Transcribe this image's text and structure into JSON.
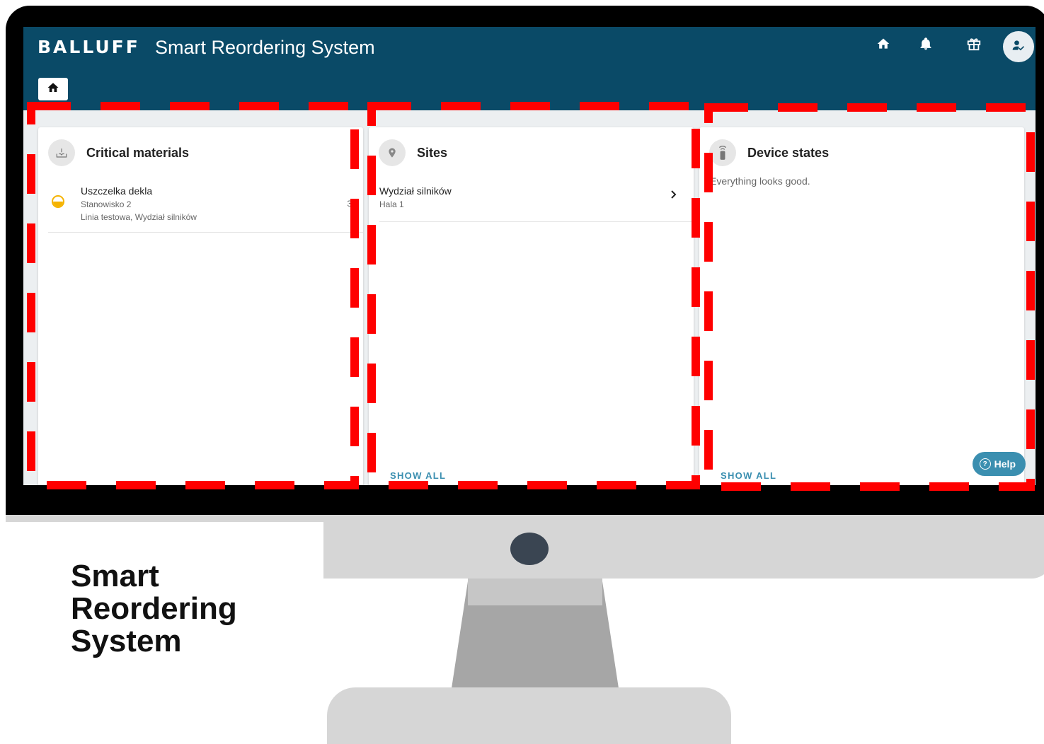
{
  "app": {
    "logo": "BALLUFF",
    "title": "Smart Reordering System"
  },
  "topbar_icons": [
    "home-icon",
    "bell-icon",
    "gift-icon",
    "user-check-icon"
  ],
  "cards": {
    "critical": {
      "title": "Critical materials",
      "icon": "inbox-download-icon",
      "items": [
        {
          "name": "Uszczelka dekla",
          "station": "Stanowisko 2",
          "location": "Linia testowa, Wydział silników",
          "count": "3",
          "status_color": "#f5b301"
        }
      ]
    },
    "sites": {
      "title": "Sites",
      "icon": "map-pin-icon",
      "items": [
        {
          "name": "Wydział silników",
          "sub": "Hala 1"
        }
      ],
      "show_all": "SHOW ALL"
    },
    "devices": {
      "title": "Device states",
      "icon": "remote-device-icon",
      "message": "Everything looks good.",
      "show_all": "SHOW ALL"
    }
  },
  "help": {
    "label": "Help",
    "glyph": "?"
  },
  "marketing": {
    "line1": "Smart",
    "line2": "Reordering",
    "line3": "System"
  },
  "colors": {
    "appbar": "#0a4a67",
    "accent": "#3b8fb0",
    "highlight": "#ff0000",
    "warning": "#f5b301"
  }
}
